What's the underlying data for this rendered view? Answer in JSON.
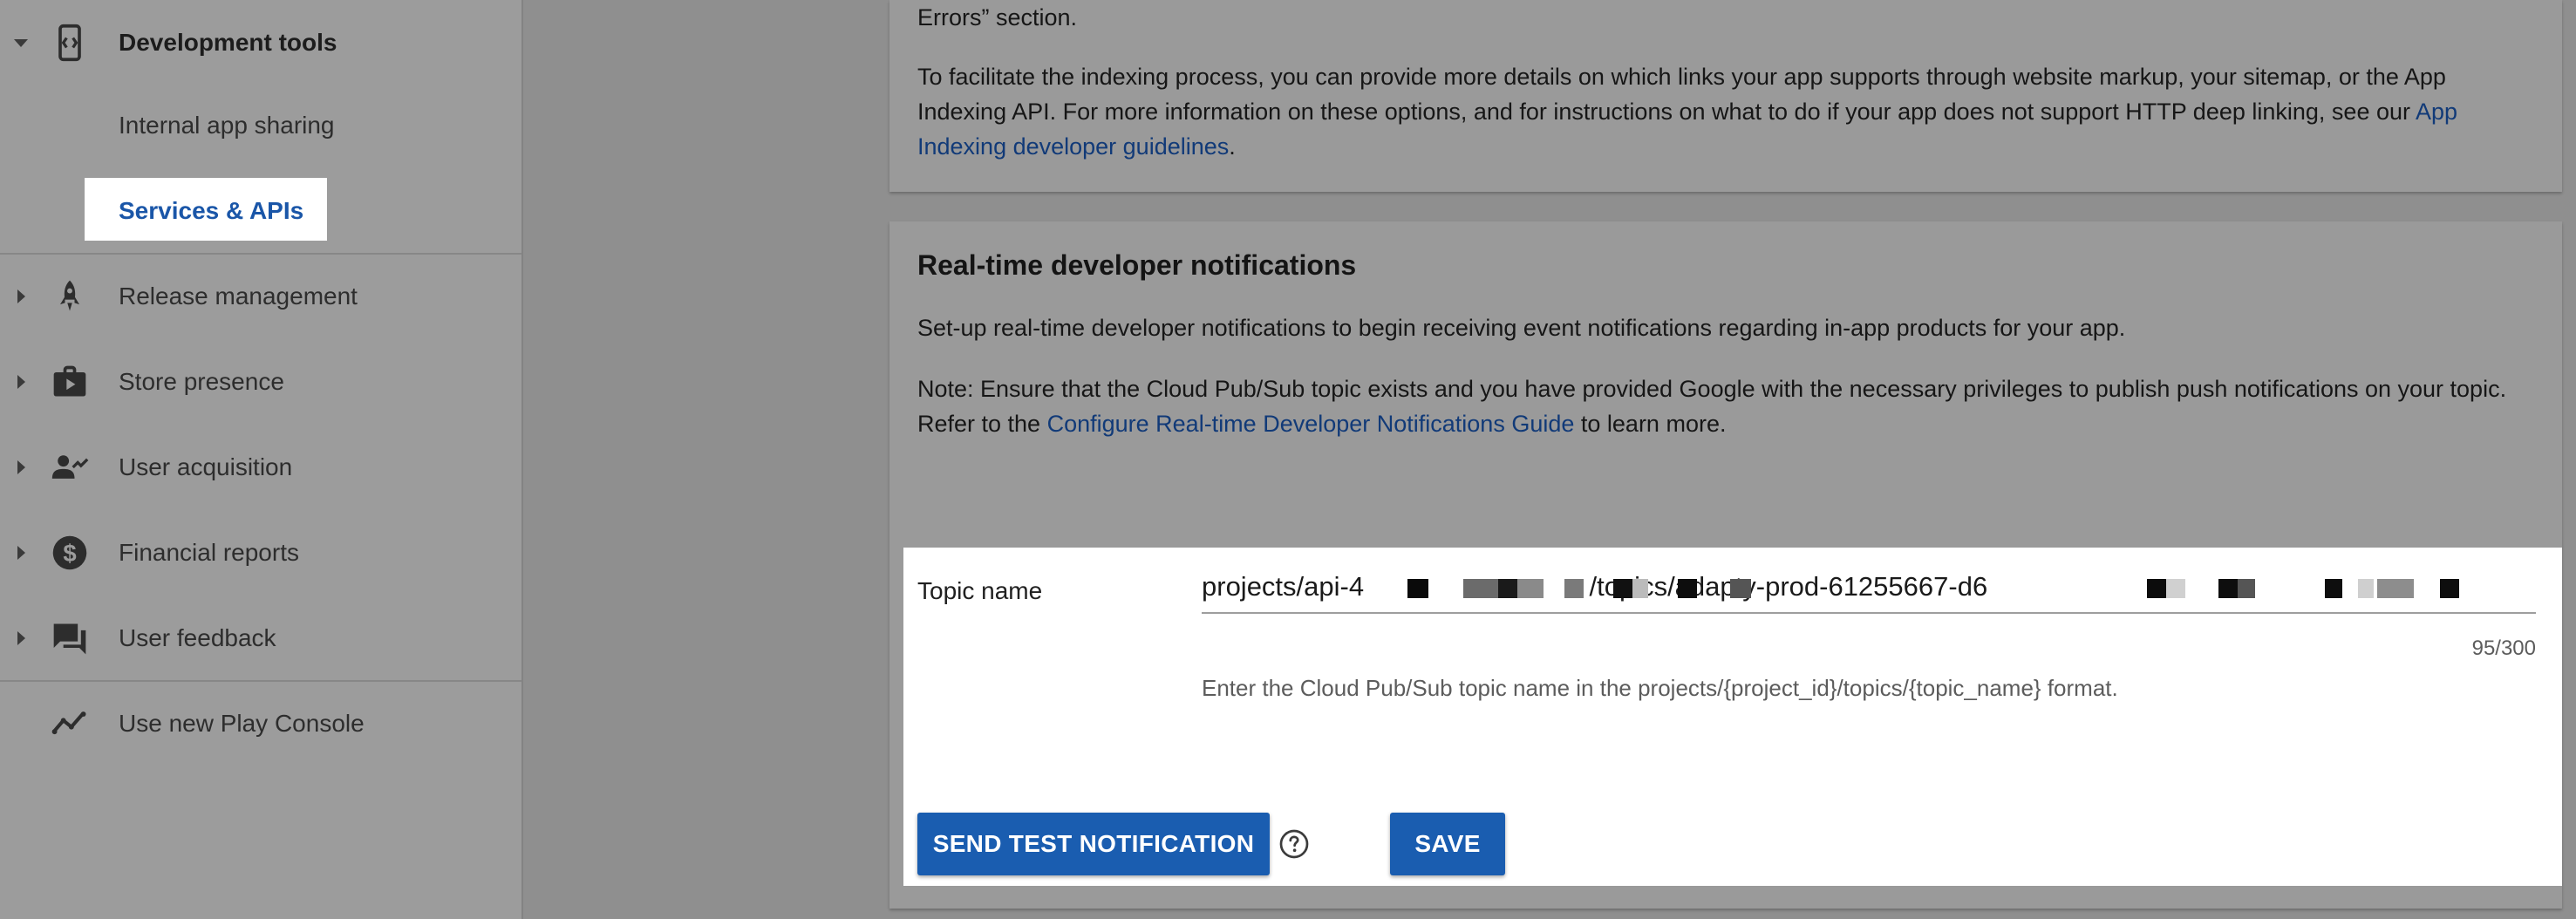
{
  "sidebar": {
    "development_tools": "Development tools",
    "internal_app_sharing": "Internal app sharing",
    "services_apis": "Services & APIs",
    "release_management": "Release management",
    "store_presence": "Store presence",
    "user_acquisition": "User acquisition",
    "financial_reports": "Financial reports",
    "user_feedback": "User feedback",
    "use_new_play_console": "Use new Play Console"
  },
  "app_indexing": {
    "text_fragment": "Errors” section.",
    "para_text": "To facilitate the indexing process, you can provide more details on which links your app supports through website markup, your sitemap, or the App Indexing API. For more information on these options, and for instructions on what to do if your app does not support HTTP deep linking, see our ",
    "link_text": "App Indexing developer guidelines",
    "para_end": "."
  },
  "rtdn": {
    "title": "Real-time developer notifications",
    "description": "Set-up real-time developer notifications to begin receiving event notifications regarding in-app products for your app.",
    "note_text": "Note: Ensure that the Cloud Pub/Sub topic exists and you have provided Google with the necessary privileges to publish push notifications on your topic. Refer to the ",
    "note_link": "Configure Real-time Developer Notifications Guide",
    "note_end": " to learn more.",
    "topic_label": "Topic name",
    "topic_value": "projects/api-4                              /topics/adapty-prod-61255667-d6",
    "counter": "95/300",
    "helper": "Enter the Cloud Pub/Sub topic name in the projects/{project_id}/topics/{topic_name} format.",
    "send_test_label": "SEND TEST NOTIFICATION",
    "save_label": "SAVE"
  },
  "colors": {
    "accent": "#1a5db0",
    "link": "#113a78",
    "active_nav": "#1a56a8"
  }
}
